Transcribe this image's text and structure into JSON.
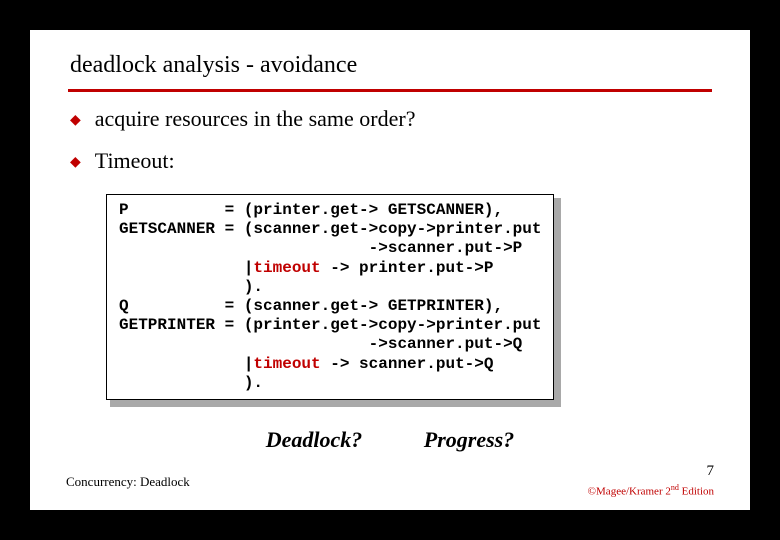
{
  "title": "deadlock analysis - avoidance",
  "bullets": {
    "b1": "acquire resources in the same order?",
    "b2": "Timeout:"
  },
  "code": {
    "l1a": "P          = (printer.get-> GETSCANNER),",
    "l2a": "GETSCANNER = (scanner.get->copy->printer.put",
    "l3a": "                          ->scanner.put->P",
    "l4a": "             |",
    "l4kw": "timeout",
    "l4b": " -> printer.put->P",
    "l5a": "             ).",
    "l6a": "Q          = (scanner.get-> GETPRINTER),",
    "l7a": "GETPRINTER = (printer.get->copy->printer.put",
    "l8a": "                          ->scanner.put->Q",
    "l9a": "             |",
    "l9kw": "timeout",
    "l9b": " -> scanner.put->Q",
    "l10a": "             )."
  },
  "questions": {
    "q1": "Deadlock?",
    "q2": "Progress?"
  },
  "footer": {
    "left": "Concurrency: Deadlock",
    "page": "7",
    "cite_prefix": "©Magee/Kramer ",
    "cite_ord": "2",
    "cite_sup": "nd",
    "cite_suffix": " Edition"
  }
}
